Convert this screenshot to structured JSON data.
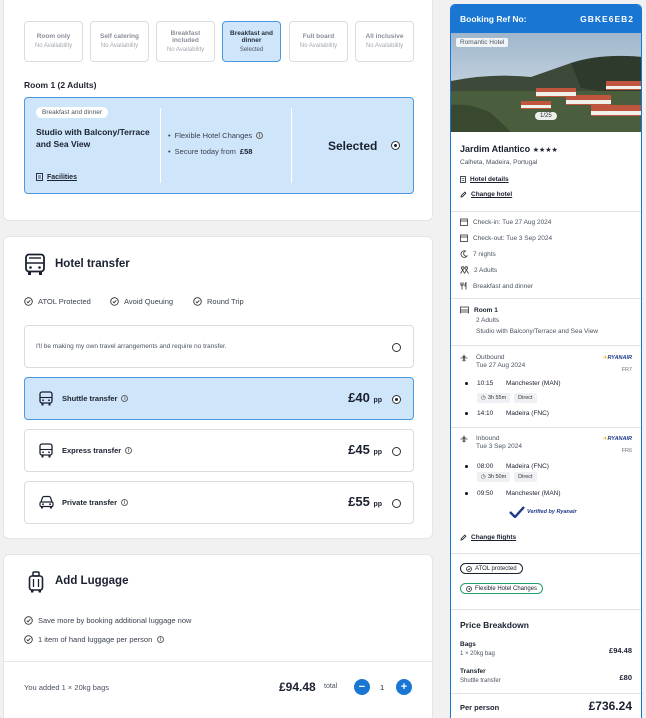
{
  "board_options": [
    {
      "name": "Room only",
      "status": "No Availability",
      "selected": false
    },
    {
      "name": "Self catering",
      "status": "No Availability",
      "selected": false
    },
    {
      "name": "Breakfast included",
      "status": "No Availability",
      "selected": false
    },
    {
      "name": "Breakfast and dinner",
      "status": "Selected",
      "selected": true
    },
    {
      "name": "Full board",
      "status": "No Availability",
      "selected": false
    },
    {
      "name": "All inclusive",
      "status": "No Availability",
      "selected": false
    }
  ],
  "room": {
    "title": "Room 1 (2 Adults)",
    "tag": "Breakfast and dinner",
    "name": "Studio with Balcony/Terrace and Sea View",
    "facilities": "Facilities",
    "feature1": "Flexible Hotel Changes",
    "feature2_prefix": "Secure today from",
    "feature2_price": "£58",
    "selected_label": "Selected"
  },
  "transfer": {
    "title": "Hotel transfer",
    "checks": [
      "ATOL Protected",
      "Avoid Queuing",
      "Round Trip"
    ],
    "no_transfer": "I'll be making my own travel arrangements and require no transfer.",
    "options": [
      {
        "label": "Shuttle transfer",
        "price": "£40",
        "unit": "pp",
        "selected": true
      },
      {
        "label": "Express transfer",
        "price": "£45",
        "unit": "pp",
        "selected": false
      },
      {
        "label": "Private transfer",
        "price": "£55",
        "unit": "pp",
        "selected": false
      }
    ]
  },
  "luggage": {
    "title": "Add Luggage",
    "checks": [
      "Save more by booking additional luggage now",
      "1 item of hand luggage per person"
    ],
    "added_text": "You added 1 × 20kg bags",
    "total_price": "£94.48",
    "total_label": "total",
    "quantity": "1",
    "minus": "−",
    "plus": "+"
  },
  "summary": {
    "ref_label": "Booking Ref No:",
    "ref_value": "GBKE6EB2",
    "image_tag": "Romantic Hotel",
    "image_count": "1/25",
    "hotel_name": "Jardim Atlantico",
    "stars": "★★★★",
    "location": "Calheta, Madeira, Portugal",
    "hotel_details": "Hotel details",
    "change_hotel": "Change hotel",
    "checkin": "Check-in: Tue 27 Aug 2024",
    "checkout": "Check-out: Tue 3 Sep 2024",
    "nights": "7 nights",
    "adults": "2 Adults",
    "board": "Breakfast and dinner",
    "room_label": "Room 1",
    "room_adults": "2 Adults",
    "room_type": "Studio with Balcony/Terrace and Sea View",
    "outbound": {
      "label": "Outbound",
      "date": "Tue 27 Aug 2024",
      "airline": "RYANAIR",
      "flight": "FR7",
      "dep_time": "10:15",
      "dep_airport": "Manchester (MAN)",
      "duration": "3h 55m",
      "stops": "Direct",
      "arr_time": "14:10",
      "arr_airport": "Madeira (FNC)"
    },
    "inbound": {
      "label": "Inbound",
      "date": "Tue 3 Sep 2024",
      "airline": "RYANAIR",
      "flight": "FR6",
      "dep_time": "08:00",
      "dep_airport": "Madeira (FNC)",
      "duration": "3h 50m",
      "stops": "Direct",
      "arr_time": "09:50",
      "arr_airport": "Manchester (MAN)"
    },
    "verified": "Verified by Ryanair",
    "change_flights": "Change flights",
    "atol": "ATOL protected",
    "flexible": "Flexible Hotel Changes",
    "price_title": "Price Breakdown",
    "bags_label": "Bags",
    "bags_detail": "1 × 20kg bag",
    "bags_price": "£94.48",
    "transfer_label": "Transfer",
    "transfer_detail": "Shuttle transfer",
    "transfer_price": "£80",
    "per_person_label": "Per person",
    "per_person_price": "£736.24"
  },
  "colors": {
    "accent": "#1976d2",
    "selected_bg": "#cfe5f9",
    "selected_border": "#4a98de"
  }
}
